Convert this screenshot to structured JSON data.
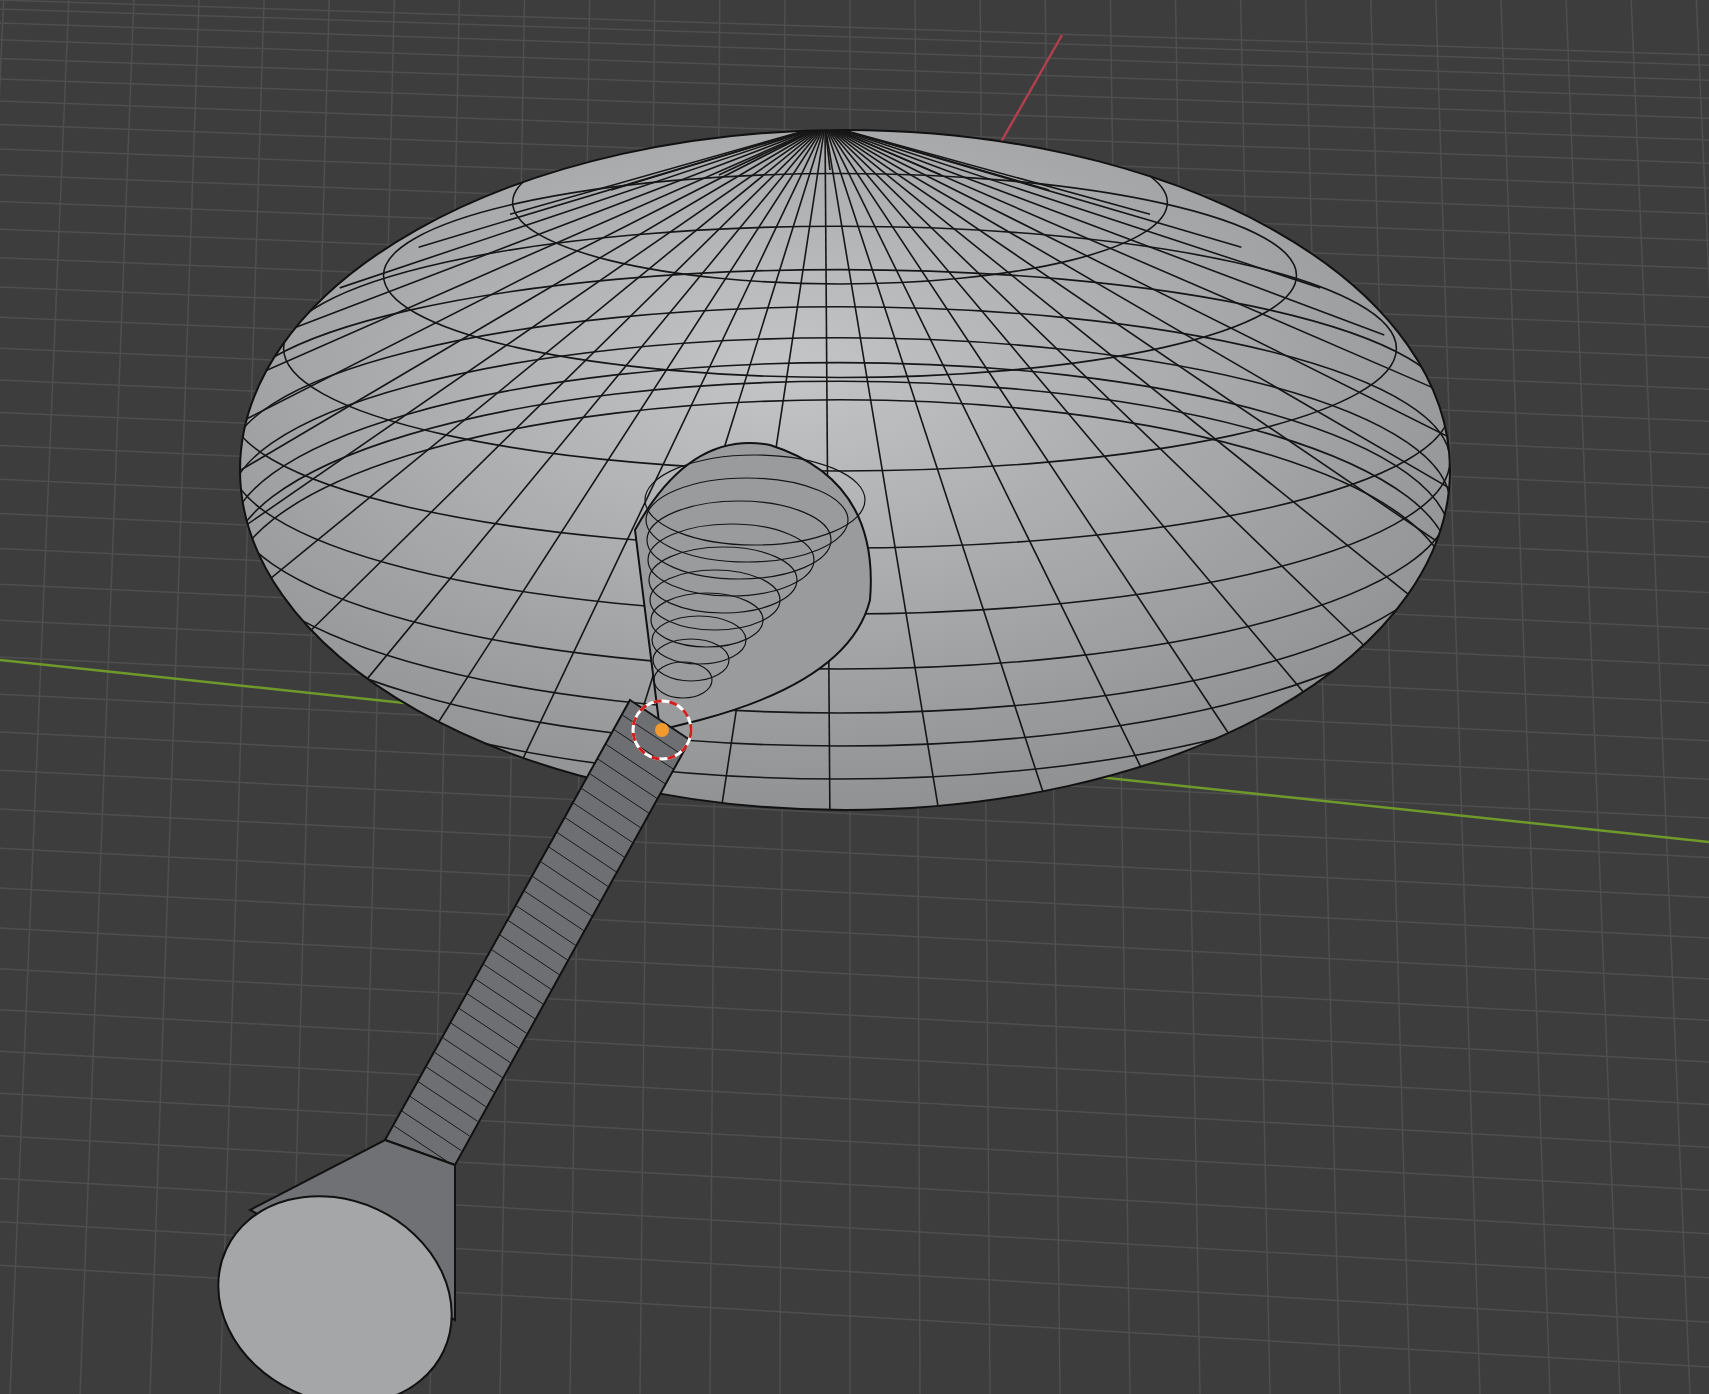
{
  "viewport": {
    "show_grid": true,
    "axes": [
      {
        "kind": "x",
        "color": "#b0404e"
      },
      {
        "kind": "y",
        "color": "#6f9a2b"
      }
    ],
    "object_selected": true
  }
}
